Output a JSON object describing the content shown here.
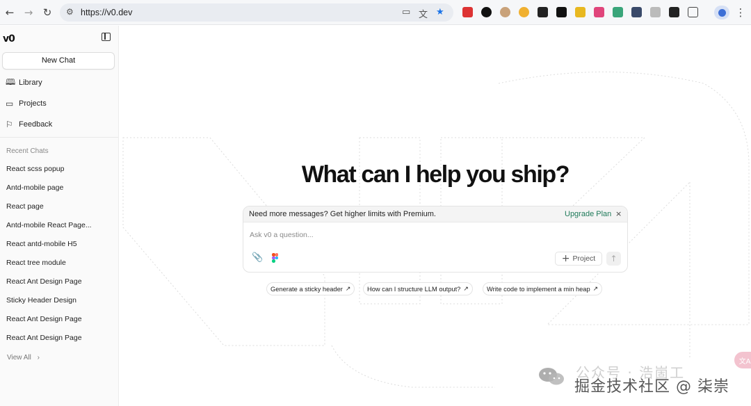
{
  "browser": {
    "url": "https://v0.dev",
    "back_icon": "←",
    "forward_icon": "→",
    "reload_icon": "↻",
    "menu_icon": "⋮",
    "bookmark_icon": "★"
  },
  "sidebar": {
    "logo": "v0",
    "new_chat_label": "New Chat",
    "nav": [
      {
        "label": "Library",
        "icon": "book-icon"
      },
      {
        "label": "Projects",
        "icon": "folder-icon"
      },
      {
        "label": "Feedback",
        "icon": "flag-icon"
      }
    ],
    "recent_label": "Recent Chats",
    "chats": [
      "React scss popup",
      "Antd-mobile page",
      "React page",
      "Antd-mobile React Page...",
      "React antd-mobile H5",
      "React tree module",
      "React Ant Design Page",
      "Sticky Header Design",
      "React Ant Design Page",
      "React Ant Design Page"
    ],
    "view_all_label": "View All"
  },
  "main": {
    "headline": "What can I help you ship?",
    "banner_text": "Need more messages? Get higher limits with Premium.",
    "upgrade_label": "Upgrade Plan",
    "close_label": "×",
    "input_placeholder": "Ask v0 a question...",
    "project_label": "Project",
    "send_icon": "↑",
    "suggestions": [
      "Generate a sticky header",
      "How can I structure LLM output?",
      "Write code to implement a min heap"
    ]
  },
  "watermark": {
    "faint_text": "公众号 · 浩崮工",
    "text": "掘金技术社区 @ 柒崇",
    "chip_text": "文A"
  }
}
